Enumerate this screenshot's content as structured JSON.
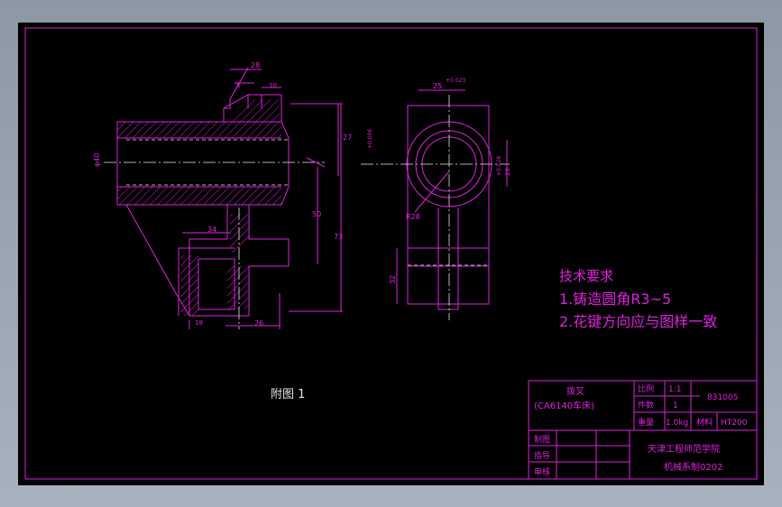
{
  "drawing": {
    "caption": "附图 1",
    "tech_req": {
      "title": "技术要求",
      "item1": "1.铸造圆角R3~5",
      "item2": "2.花键方向应与图样一致"
    },
    "dims": {
      "d28": "28",
      "d8": "8",
      "d10": "10",
      "d27": "27",
      "d50": "50",
      "d73": "73",
      "d34": "34",
      "d26": "26",
      "d18": "18",
      "phi40": "φ40",
      "d25": "25",
      "d25tol": "+0.023",
      "d20": "20",
      "d22tol": "+0.028",
      "r28": "R28",
      "d32": "32",
      "d6tol": "+0.006"
    },
    "title_block": {
      "part_name": "拨叉",
      "machine": "(CA6140车床)",
      "scale_label": "比例",
      "scale_value": "1:1",
      "qty_label": "件数",
      "qty_value": "1",
      "weight_label": "重量",
      "weight_value": "1.0kg",
      "material_label": "材料",
      "material_value": "HT200",
      "drawing_no": "831005",
      "drawn_label": "制图",
      "designed_label": "指导",
      "checked_label": "审核",
      "school": "天津工程师范学院",
      "class": "机械系制0202"
    }
  }
}
